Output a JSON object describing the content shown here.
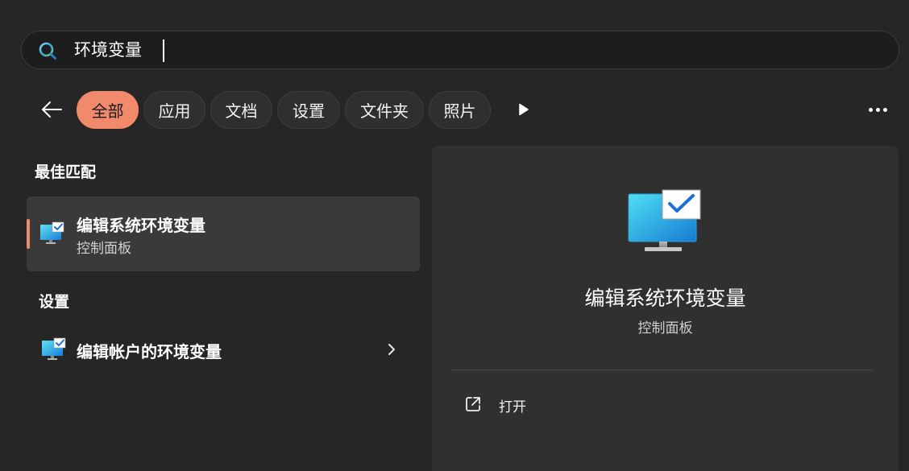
{
  "search": {
    "query": "环境变量",
    "icon": "search-icon"
  },
  "filters": {
    "back_icon": "arrow-left-icon",
    "chips": [
      {
        "label": "全部",
        "active": true
      },
      {
        "label": "应用",
        "active": false
      },
      {
        "label": "文档",
        "active": false
      },
      {
        "label": "设置",
        "active": false
      },
      {
        "label": "文件夹",
        "active": false
      },
      {
        "label": "照片",
        "active": false
      }
    ],
    "more_scroll_icon": "play-icon",
    "overflow_icon": "more-horizontal-icon",
    "accent_color": "#f08a6a"
  },
  "best_match": {
    "heading": "最佳匹配",
    "title": "编辑系统环境变量",
    "subtitle": "控制面板",
    "icon": "monitor-check-icon"
  },
  "settings_section": {
    "heading": "设置",
    "items": [
      {
        "title": "编辑帐户的环境变量",
        "icon": "monitor-check-icon"
      }
    ]
  },
  "preview": {
    "icon": "monitor-check-icon",
    "title": "编辑系统环境变量",
    "subtitle": "控制面板",
    "actions": [
      {
        "label": "打开",
        "icon": "open-external-icon"
      }
    ]
  }
}
